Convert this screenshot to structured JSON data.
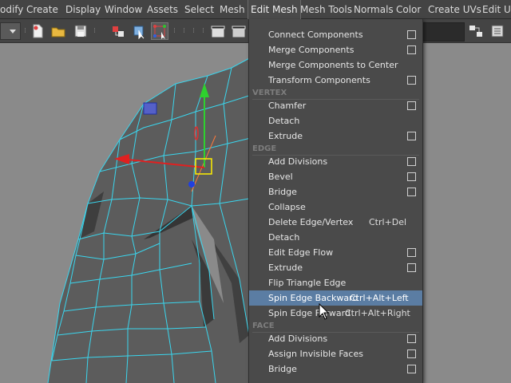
{
  "menubar": {
    "items": [
      "odify",
      "Create",
      "Display",
      "Window",
      "Assets",
      "Select",
      "Mesh",
      "Edit Mesh",
      "Mesh Tools",
      "Normals",
      "Color",
      "Create UVs",
      "Edit UV"
    ]
  },
  "edit_mesh_menu": {
    "items": [
      {
        "label": "Connect Components",
        "option_box": true
      },
      {
        "label": "Merge Components",
        "option_box": true
      },
      {
        "label": "Merge Components to Center",
        "option_box": false
      },
      {
        "label": "Transform Components",
        "option_box": true
      },
      {
        "section": "VERTEX"
      },
      {
        "label": "Chamfer",
        "option_box": true
      },
      {
        "label": "Detach",
        "option_box": false
      },
      {
        "label": "Extrude",
        "option_box": true
      },
      {
        "section": "EDGE"
      },
      {
        "label": "Add Divisions",
        "option_box": true
      },
      {
        "label": "Bevel",
        "option_box": true
      },
      {
        "label": "Bridge",
        "option_box": true
      },
      {
        "label": "Collapse",
        "option_box": false
      },
      {
        "label": "Delete Edge/Vertex",
        "shortcut": "Ctrl+Del",
        "option_box": false
      },
      {
        "label": "Detach",
        "option_box": false
      },
      {
        "label": "Edit Edge Flow",
        "option_box": true
      },
      {
        "label": "Extrude",
        "option_box": true
      },
      {
        "label": "Flip Triangle Edge",
        "option_box": false
      },
      {
        "label": "Spin Edge Backward",
        "shortcut": "Ctrl+Alt+Left",
        "option_box": false,
        "highlighted": true
      },
      {
        "label": "Spin Edge Forward",
        "shortcut": "Ctrl+Alt+Right",
        "option_box": false
      },
      {
        "section": "FACE"
      },
      {
        "label": "Add Divisions",
        "option_box": true
      },
      {
        "label": "Assign Invisible Faces",
        "option_box": true
      },
      {
        "label": "Bridge",
        "option_box": true
      }
    ]
  },
  "colors": {
    "ui_bg": "#444444",
    "menu_bg": "#4a4a4a",
    "highlight": "#5b7da3",
    "viewport_bg": "#8a8a8a",
    "mesh_face": "#5a5a5a",
    "wire": "#39d8f0"
  },
  "icons": [
    "mode-dropdown-icon",
    "new-scene-icon",
    "open-scene-icon",
    "save-scene-icon",
    "select-hierarchy-icon",
    "select-object-icon",
    "select-component-icon",
    "render-clapper-icon",
    "ipr-render-icon",
    "hypershade-icon",
    "render-settings-icon",
    "move-tool-manipulator-icon",
    "mouse-cursor-icon"
  ]
}
